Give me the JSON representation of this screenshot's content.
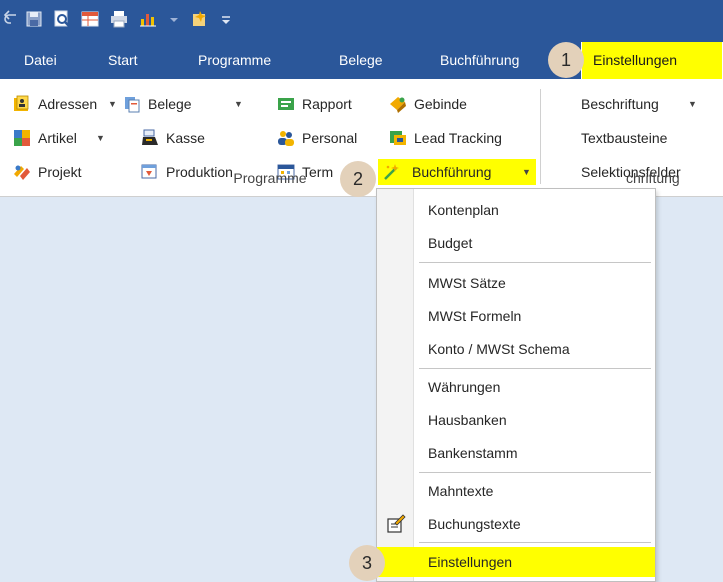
{
  "quick_access": {
    "icons": [
      "back-arrow-icon",
      "save-disk-icon",
      "print-preview-icon",
      "table-icon",
      "printer-icon",
      "chart-icon",
      "wizard-icon",
      "customize-arrow-icon"
    ]
  },
  "tabs": [
    {
      "label": "Datei",
      "active": false
    },
    {
      "label": "Start",
      "active": false
    },
    {
      "label": "Programme",
      "active": false
    },
    {
      "label": "Belege",
      "active": false
    },
    {
      "label": "Buchführung",
      "active": false
    },
    {
      "label": "Einstellungen",
      "active": true
    }
  ],
  "ribbon": {
    "programme": {
      "adressen": "Adressen",
      "belege": "Belege",
      "rapport": "Rapport",
      "gebinde": "Gebinde",
      "artikel": "Artikel",
      "kasse": "Kasse",
      "personal": "Personal",
      "lead_tracking": "Lead Tracking",
      "projekt": "Projekt",
      "produktion": "Produktion",
      "termine": "Term",
      "buchfuehrung": "Buchführung",
      "group_label": "Programme"
    },
    "right": {
      "beschriftung": "Beschriftung",
      "textbausteine": "Textbausteine",
      "selektionsfelder": "Selektionsfelder",
      "group_label": "chriftung"
    }
  },
  "dropdown": {
    "items": [
      {
        "label": "Kontenplan"
      },
      {
        "label": "Budget"
      },
      {
        "label": "MWSt Sätze"
      },
      {
        "label": "MWSt Formeln"
      },
      {
        "label": "Konto / MWSt Schema"
      },
      {
        "label": "Währungen"
      },
      {
        "label": "Hausbanken"
      },
      {
        "label": "Bankenstamm"
      },
      {
        "label": "Mahntexte"
      },
      {
        "label": "Buchungstexte",
        "icon": "notepad-edit-icon"
      },
      {
        "label": "Einstellungen",
        "highlighted": true
      }
    ]
  },
  "annotations": {
    "step1": "1",
    "step2": "2",
    "step3": "3"
  },
  "colors": {
    "ribbon_blue": "#2b579a",
    "highlight": "#ffff00",
    "badge": "#e3d1ba",
    "workspace": "#dee8f4"
  }
}
